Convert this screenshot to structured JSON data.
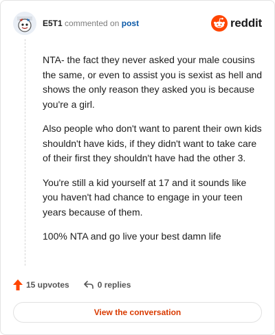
{
  "comment": {
    "author": "E5T1",
    "verb": "commented on",
    "post_link": "post",
    "paragraphs": [
      "NTA- the fact they never asked your male cousins the same, or even to assist you is sexist as hell and shows the only reason they asked you is because you're a girl.",
      "Also people who don't want to parent their own kids shouldn't have kids, if they didn't want to take care of their first they shouldn't have had the other 3.",
      "You're still a kid yourself at 17 and it sounds like you haven't had chance to engage in your teen years because of them.",
      "100% NTA and go live your best damn life"
    ]
  },
  "brand": {
    "wordmark": "reddit",
    "color": "#ff4500"
  },
  "actions": {
    "upvotes_label": "15 upvotes",
    "replies_label": "0 replies"
  },
  "view_button": "View the conversation",
  "icons": [
    "avatar-image",
    "reddit-logo-icon",
    "upvote-arrow-icon",
    "reply-icon"
  ]
}
